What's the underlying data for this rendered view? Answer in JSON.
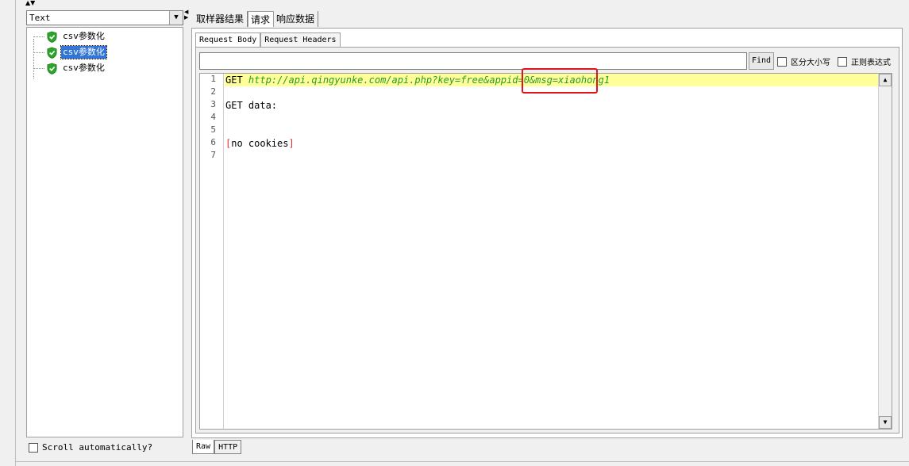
{
  "sidebar": {
    "view_mode": "Text",
    "tree_items": [
      {
        "label": "csv参数化",
        "selected": false
      },
      {
        "label": "csv参数化",
        "selected": true
      },
      {
        "label": "csv参数化",
        "selected": false
      }
    ],
    "scroll_auto_label": "Scroll automatically?"
  },
  "tabs": [
    {
      "label": "取样器结果"
    },
    {
      "label": "请求"
    },
    {
      "label": "响应数据"
    }
  ],
  "subtabs": [
    {
      "label": "Request Body"
    },
    {
      "label": "Request Headers"
    }
  ],
  "search": {
    "value": "",
    "find_label": "Find",
    "case_label": "区分大小写",
    "regex_label": "正则表达式"
  },
  "editor": {
    "line_numbers": [
      "1",
      "2",
      "3",
      "4",
      "5",
      "6",
      "7"
    ],
    "line1_method": "GET ",
    "line1_url": "http://api.qingyunke.com/api.php?key=free&appid=0&msg=xiaohong1",
    "line3": "GET data:",
    "line6_open": "[",
    "line6_text": "no cookies",
    "line6_close": "]"
  },
  "bottom_tabs": [
    {
      "label": "Raw"
    },
    {
      "label": "HTTP"
    }
  ],
  "colors": {
    "selection": "#3375d6",
    "highlight_line": "#ffff99",
    "url_text": "#2a9a2a",
    "bracket": "#d33333",
    "annotation_box": "#e0141e",
    "success_icon": "#2aa52a"
  }
}
